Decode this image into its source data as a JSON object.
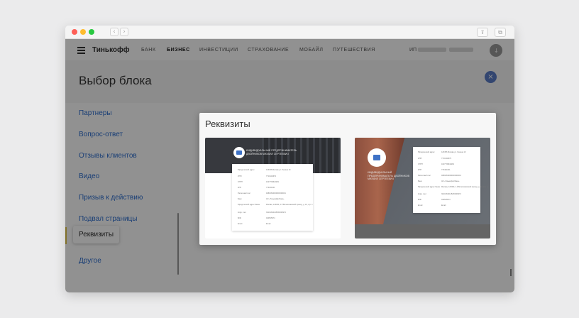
{
  "window": {
    "controls": [
      "close",
      "minimize",
      "zoom"
    ],
    "nav_back_icon": "‹",
    "nav_forward_icon": "›",
    "share_icon": "⇪",
    "tabs_icon": "⧉"
  },
  "topnav": {
    "brand": "Тинькофф",
    "links": [
      "БАНК",
      "БИЗНЕС",
      "ИНВЕСТИЦИИ",
      "СТРАХОВАНИЕ",
      "МОБАЙЛ",
      "ПУТЕШЕСТВИЯ"
    ],
    "active_link": "БИЗНЕС",
    "user_prefix": "ИП",
    "avatar_icon": "↓"
  },
  "block_picker": {
    "title": "Выбор блока",
    "close_icon": "×",
    "menu": [
      "Партнеры",
      "Вопрос-ответ",
      "Отзывы клиентов",
      "Видео",
      "Призыв к действию",
      "Подвал страницы",
      "Реквизиты",
      "Другое"
    ],
    "active_item": "Реквизиты"
  },
  "modal": {
    "title": "Реквизиты",
    "card1": {
      "hero_text": "ИНДИВИДУАЛЬНЫЙ ПРЕДПРИНИМАТЕЛЬ ДВОЙНИКОВ МИХАИЛ СЕРГЕЕВИЧ",
      "rows": [
        {
          "label": "Юридический адрес",
          "value": "123456 Москва ул. Ленина 10"
        },
        {
          "label": "ИНН",
          "value": "7710140679"
        },
        {
          "label": "ОГРН",
          "value": "1027739642281"
        },
        {
          "label": "КПП",
          "value": "773401001"
        },
        {
          "label": "Расчетный счет",
          "value": "40802810000000000001"
        },
        {
          "label": "Банк",
          "value": "АО «Тинькофф Банк»"
        },
        {
          "label": "Юридический адрес банка",
          "value": "Москва, 123060, 1-й Волоколамский проезд, д. 10, стр. 1"
        },
        {
          "label": "Корр. счет",
          "value": "30101810145250000974"
        },
        {
          "label": "БИК",
          "value": "044525974"
        },
        {
          "label": "Email",
          "value": "Email"
        }
      ]
    },
    "card2": {
      "hero_text": "ИНДИВИДУАЛЬНЫЙ ПРЕДПРИНИМАТЕЛЬ ДВОЙНИКОВ МИХАИЛ СЕРГЕЕВИЧ",
      "rows": [
        {
          "label": "Юридический адрес",
          "value": "123456 Москва ул. Ленина 10"
        },
        {
          "label": "ИНН",
          "value": "7710140679"
        },
        {
          "label": "ОГРН",
          "value": "1027739642281"
        },
        {
          "label": "КПП",
          "value": "773401001"
        },
        {
          "label": "Расчетный счет",
          "value": "40802810000000000001"
        },
        {
          "label": "Банк",
          "value": "АО «Тинькофф Банк»"
        },
        {
          "label": "Юридический адрес банка",
          "value": "Москва, 123060, 1-й Волоколамский проезд, д. 10, стр. 1"
        },
        {
          "label": "Корр. счет",
          "value": "30101810145250000974"
        },
        {
          "label": "БИК",
          "value": "044525974"
        },
        {
          "label": "Email",
          "value": "Email"
        }
      ]
    }
  },
  "colors": {
    "accent_blue": "#2f6fcf",
    "close_button": "#5a7cc5",
    "active_marker": "#e1c547",
    "overlay": "rgba(0,0,0,0.43)"
  }
}
